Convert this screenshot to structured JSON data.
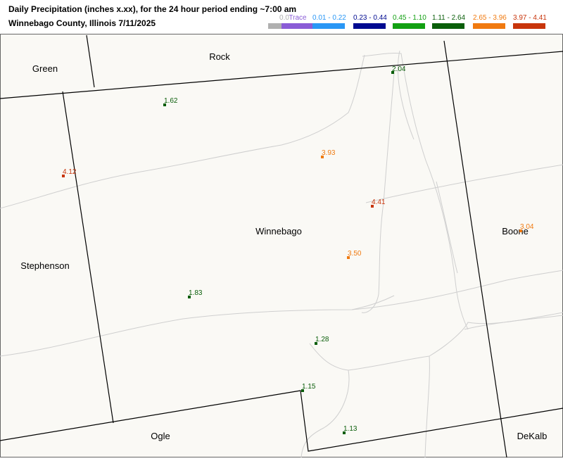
{
  "title": {
    "line1": "Daily Precipitation (inches  x.xx),  for the 24 hour period ending ~7:00 am",
    "line2": "Winnebago County, Illinois  7/11/2025"
  },
  "legend": [
    {
      "label": "0.0",
      "color": "#b0b0b0"
    },
    {
      "label": "Trace",
      "color": "#8a5cd6"
    },
    {
      "label": "0.01 - 0.22",
      "color": "#2a97f5"
    },
    {
      "label": "0.23 - 0.44",
      "color": "#000a90"
    },
    {
      "label": "0.45 - 1.10",
      "color": "#12a012"
    },
    {
      "label": "1.11 - 2.64",
      "color": "#0a5e0a"
    },
    {
      "label": "2.65 - 3.96",
      "color": "#f07a10"
    },
    {
      "label": "3.97 - 4.41",
      "color": "#c8350c"
    }
  ],
  "counties": {
    "rock": "Rock",
    "green": "Green",
    "winnebago": "Winnebago",
    "stephenson": "Stephenson",
    "boone": "Boone",
    "ogle": "Ogle",
    "dekalb": "DeKalb"
  },
  "stations": [
    {
      "value": "2.04",
      "color": "#0a5e0a"
    },
    {
      "value": "1.62",
      "color": "#0a5e0a"
    },
    {
      "value": "3.93",
      "color": "#f07a10"
    },
    {
      "value": "4.12",
      "color": "#c8350c"
    },
    {
      "value": "4.41",
      "color": "#c8350c"
    },
    {
      "value": "3.04",
      "color": "#f07a10"
    },
    {
      "value": "3.50",
      "color": "#f07a10"
    },
    {
      "value": "1.83",
      "color": "#0a5e0a"
    },
    {
      "value": "1.28",
      "color": "#0a5e0a"
    },
    {
      "value": "1.15",
      "color": "#0a5e0a"
    },
    {
      "value": "1.13",
      "color": "#0a5e0a"
    }
  ]
}
